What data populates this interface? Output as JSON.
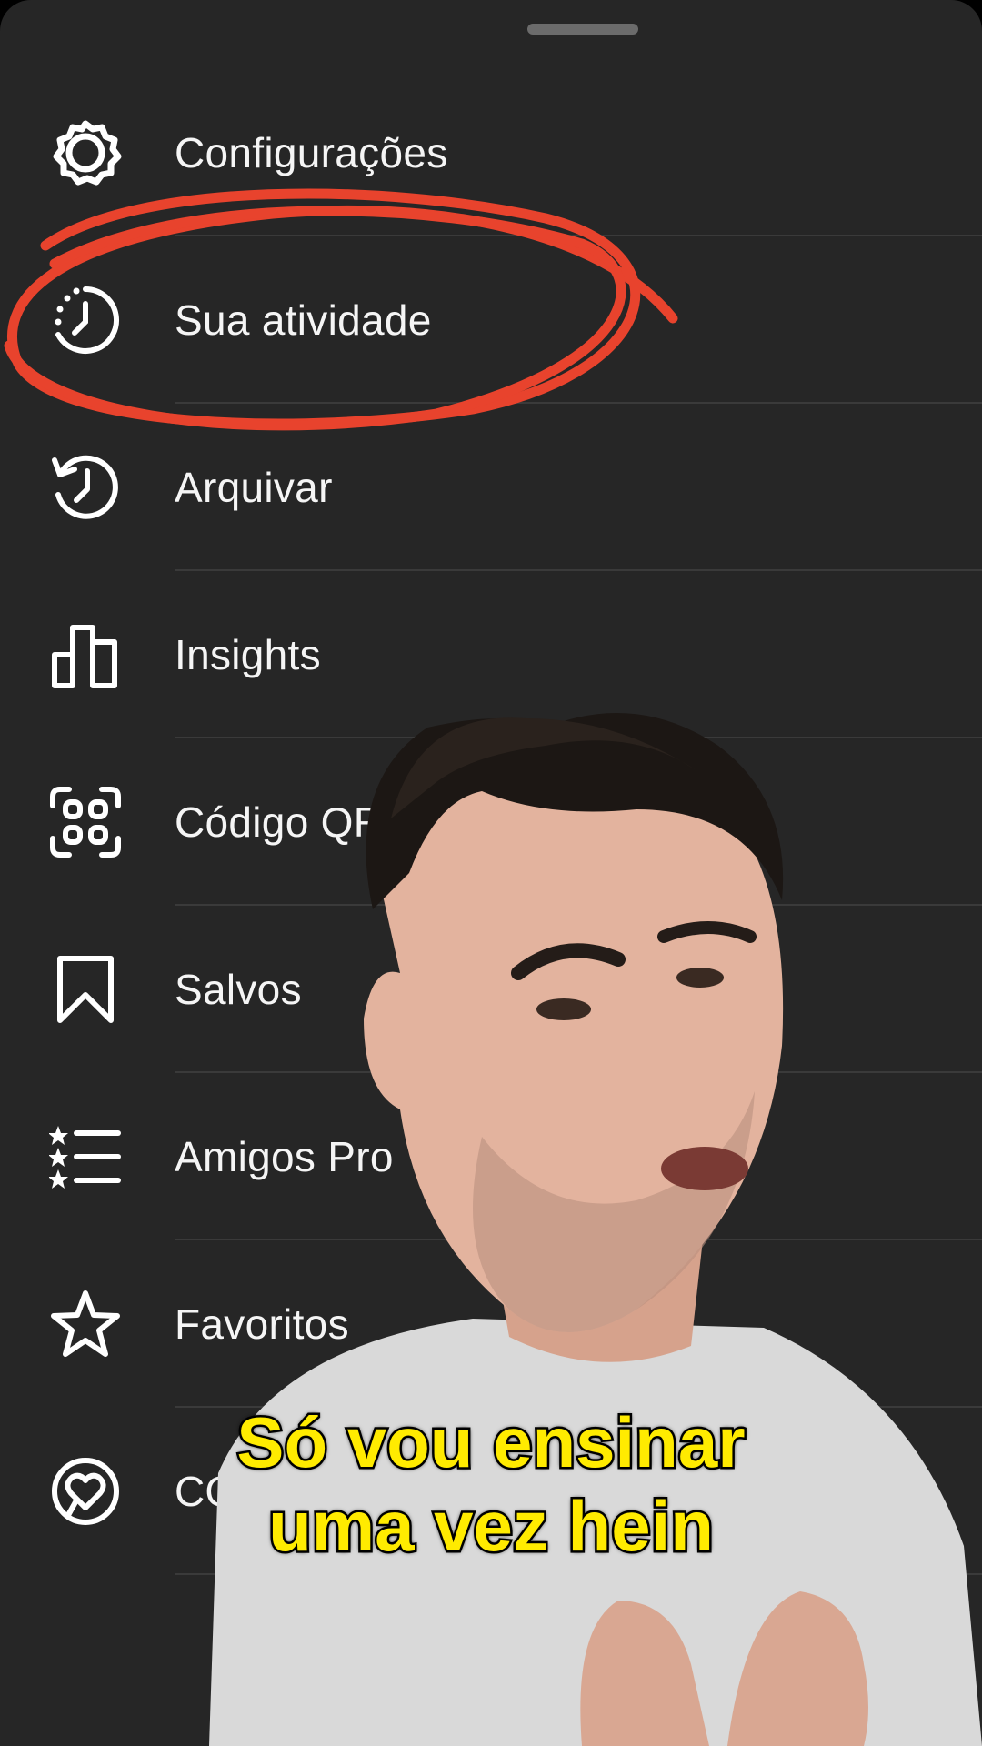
{
  "menu": {
    "items": [
      {
        "label": "Configurações",
        "icon": "gear-icon"
      },
      {
        "label": "Sua atividade",
        "icon": "activity-clock-icon"
      },
      {
        "label": "Arquivar",
        "icon": "archive-history-icon"
      },
      {
        "label": "Insights",
        "icon": "bar-chart-icon"
      },
      {
        "label": "Código QR",
        "icon": "qr-code-icon"
      },
      {
        "label": "Salvos",
        "icon": "bookmark-icon"
      },
      {
        "label": "Amigos Pro",
        "icon": "close-friends-list-icon"
      },
      {
        "label": "Favoritos",
        "icon": "star-icon"
      },
      {
        "label": "CO",
        "icon": "covid-heart-icon"
      }
    ]
  },
  "caption": {
    "line1": "Só vou ensinar",
    "line2": "uma vez hein"
  },
  "colors": {
    "sheet_background": "#262626",
    "annotation_circle": "#e8432d",
    "caption_text": "#ffeb00"
  }
}
